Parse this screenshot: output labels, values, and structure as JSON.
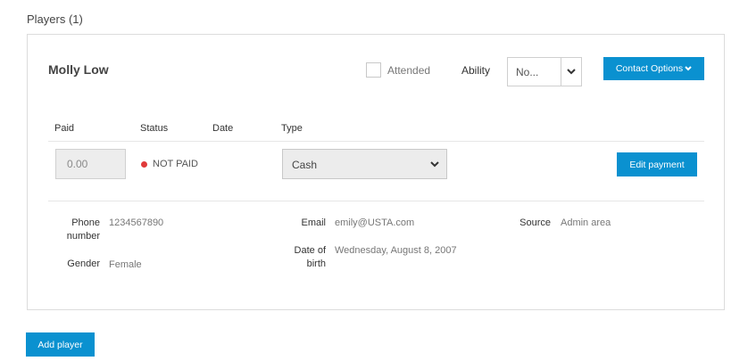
{
  "section": {
    "title": "Players (1)"
  },
  "player": {
    "name": "Molly Low",
    "attended_label": "Attended",
    "attended_checked": false,
    "ability_label": "Ability",
    "ability_value": "No...",
    "contact_button": "Contact Options"
  },
  "payment": {
    "columns": [
      "Paid",
      "Status",
      "Date",
      "Type"
    ],
    "paid_value": "0.00",
    "status_text": "NOT PAID",
    "status_color": "#e03a3a",
    "date_value": "",
    "type_value": "Cash",
    "edit_button": "Edit payment"
  },
  "details": {
    "phone_label": "Phone number",
    "phone_value": "1234567890",
    "gender_label": "Gender",
    "gender_value": "Female",
    "email_label": "Email",
    "email_value": "emily@USTA.com",
    "dob_label": "Date of birth",
    "dob_value": "Wednesday, August 8, 2007",
    "source_label": "Source",
    "source_value": "Admin area"
  },
  "footer": {
    "add_button": "Add player"
  },
  "colors": {
    "accent": "#0a91d0",
    "border": "#dcdcdc"
  }
}
